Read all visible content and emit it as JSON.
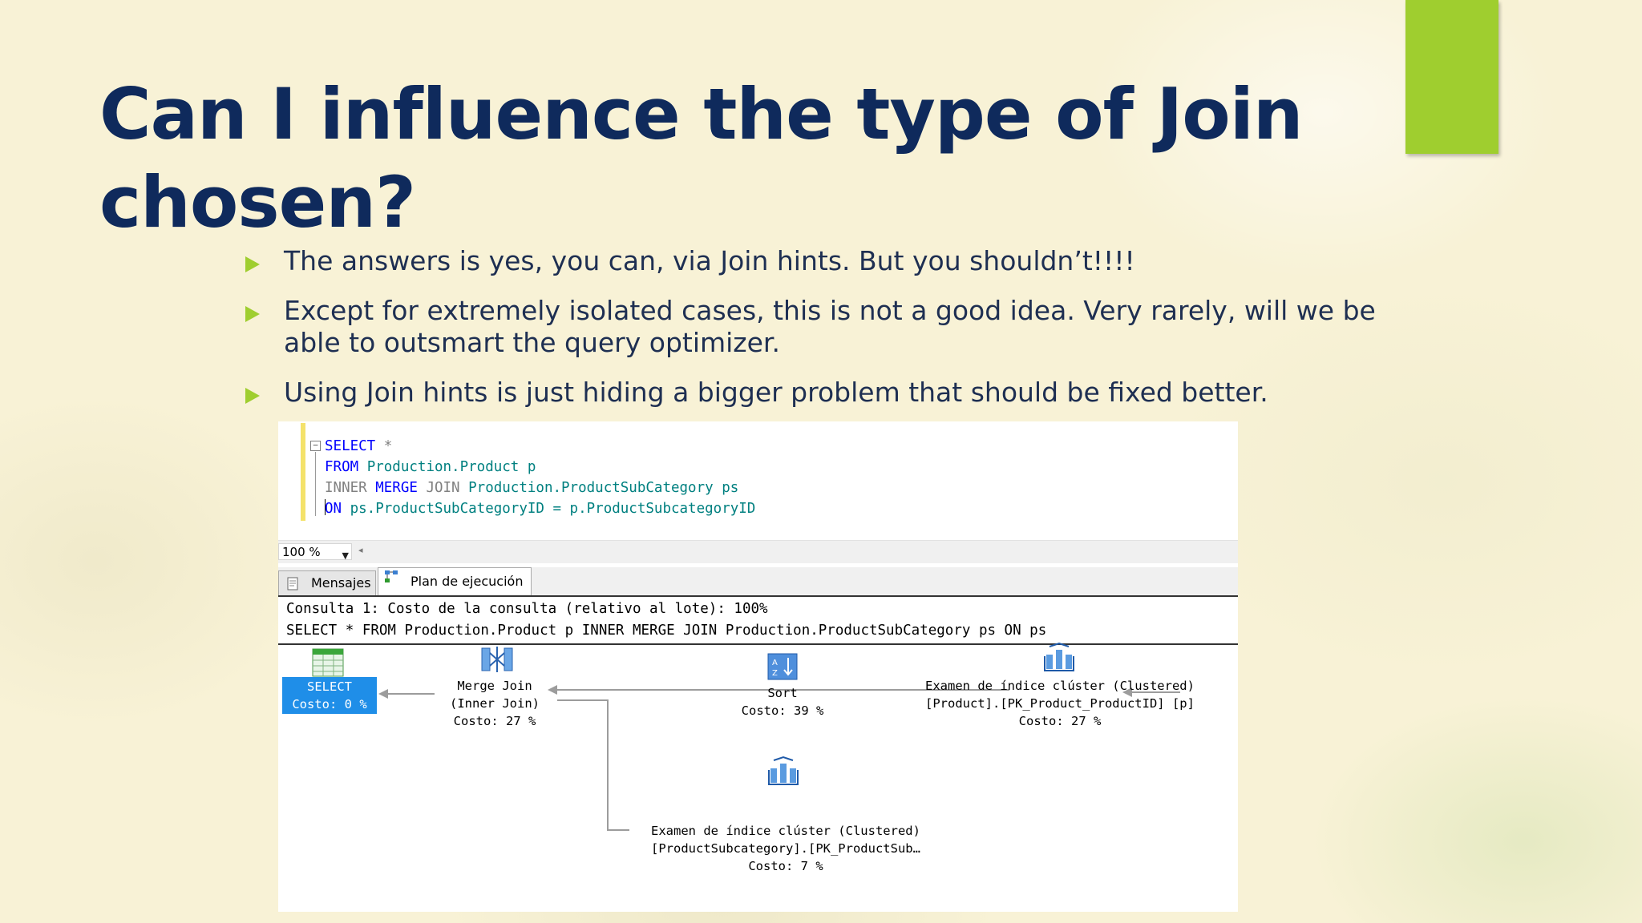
{
  "slide": {
    "title": "Can I influence the type of Join chosen?",
    "accent_color": "#9fce2f",
    "title_color": "#0f2a5c",
    "bullets": [
      "The answers is yes, you can, via Join hints. But you shouldn’t!!!!",
      "Except for extremely isolated cases, this is not a good idea. Very rarely, will we be able to outsmart the query optimizer.",
      "Using Join hints is just hiding a bigger problem that should be fixed better."
    ]
  },
  "editor": {
    "line1": {
      "kw": "SELECT",
      "rest": " *"
    },
    "line2": {
      "kw": "FROM",
      "obj": " Production.Product p"
    },
    "line3": {
      "gray1": "INNER ",
      "kw": "MERGE",
      "gray2": " JOIN ",
      "obj": "Production.ProductSubCategory ps"
    },
    "line4": {
      "kw": "ON",
      "obj": " ps.ProductSubCategoryID = p.ProductSubcategoryID"
    }
  },
  "zoom": {
    "value": "100 %"
  },
  "tabs": {
    "messages": "Mensajes",
    "plan": "Plan de ejecución"
  },
  "results": {
    "query_cost": "Consulta 1: Costo de la consulta (relativo al lote): 100%",
    "query_text": "SELECT * FROM Production.Product p INNER MERGE JOIN Production.ProductSubCategory ps ON ps"
  },
  "plan": {
    "select": {
      "name": "SELECT",
      "cost": "Costo: 0 %"
    },
    "merge": {
      "name": "Merge Join",
      "sub": "(Inner Join)",
      "cost": "Costo: 27 %"
    },
    "sort": {
      "name": "Sort",
      "cost": "Costo: 39 %"
    },
    "scan_product": {
      "name": "Examen de índice clúster (Clustered)",
      "object": "[Product].[PK_Product_ProductID] [p]",
      "cost": "Costo: 27 %"
    },
    "scan_subcat": {
      "name": "Examen de índice clúster (Clustered)",
      "object": "[ProductSubcategory].[PK_ProductSub…",
      "cost": "Costo: 7 %"
    }
  }
}
